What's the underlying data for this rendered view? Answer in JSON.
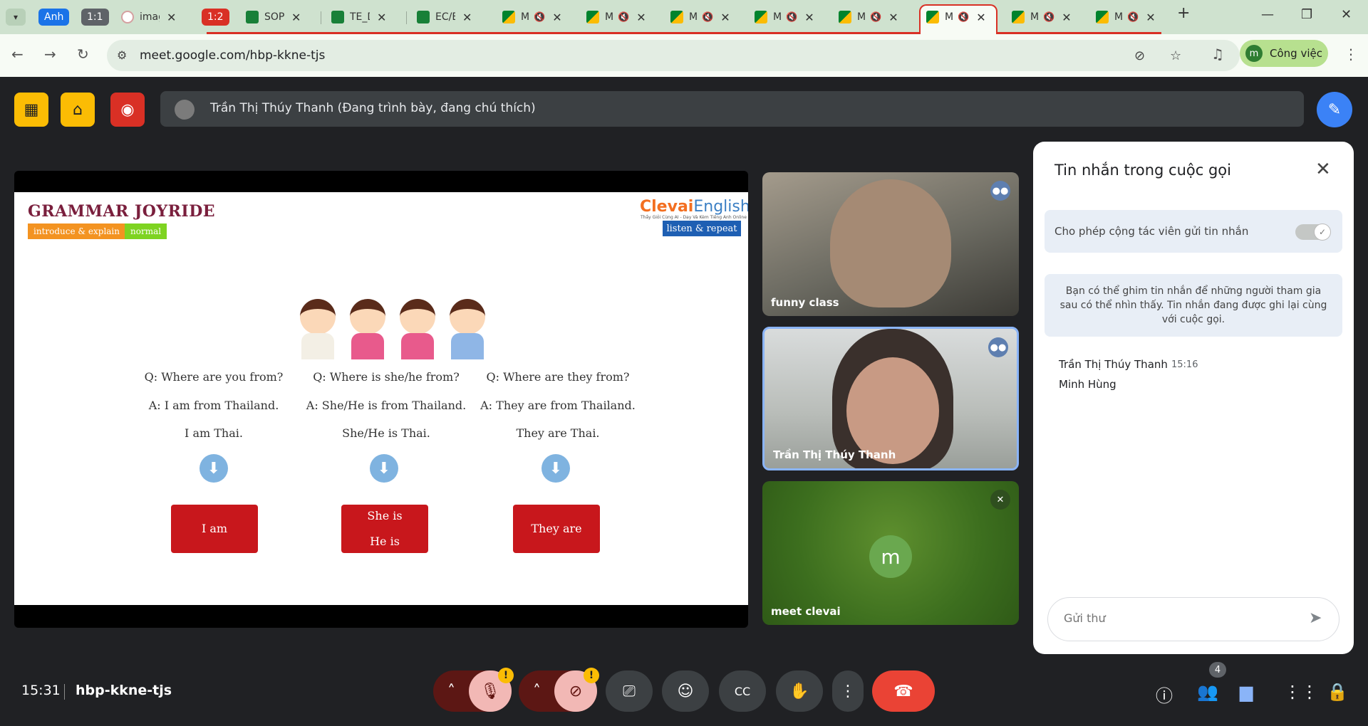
{
  "browser": {
    "tab_groups": [
      {
        "label": "Anh",
        "color": "#1a73e8"
      },
      {
        "label": "1:1",
        "color": "#5f6368"
      },
      {
        "label": "1:2",
        "color": "#d93025"
      }
    ],
    "tabs": [
      {
        "title": "imag"
      },
      {
        "title": "SOP"
      },
      {
        "title": "TE_D"
      },
      {
        "title": "EC/E"
      },
      {
        "title": "M"
      },
      {
        "title": "M"
      },
      {
        "title": "M"
      },
      {
        "title": "M"
      },
      {
        "title": "M"
      },
      {
        "title": "M"
      },
      {
        "title": "M"
      },
      {
        "title": "M"
      }
    ],
    "url": "meet.google.com/hbp-kkne-tjs",
    "profile_initial": "m",
    "profile_name": "Công việc"
  },
  "meet": {
    "presenter_text": "Trần Thị Thúy Thanh (Đang trình bày, đang chú thích)",
    "slide": {
      "title": "GRAMMAR JOYRIDE",
      "tag1": "introduce & explain",
      "tag2": "normal",
      "logo_main": "Clevai",
      "logo_eng": "English",
      "logo_sub": "Thầy Giỏi Cùng AI - Dạy Và Kèm Tiếng Anh Online",
      "listen": "listen & repeat",
      "columns": [
        {
          "q": "Q: Where are you from?",
          "a": "A: I am from Thailand.",
          "b": "I am Thai.",
          "box1": "I am",
          "box2": ""
        },
        {
          "q": "Q: Where is she/he from?",
          "a": "A: She/He is from Thailand.",
          "b": "She/He is Thai.",
          "box1": "She is",
          "box2": "He is"
        },
        {
          "q": "Q: Where are they from?",
          "a": "A: They are from Thailand.",
          "b": "They are Thai.",
          "box1": "They are",
          "box2": ""
        }
      ]
    },
    "participants": [
      {
        "name": "funny class"
      },
      {
        "name": "Trần Thị Thúy Thanh"
      },
      {
        "name": "meet clevai",
        "initial": "m"
      }
    ],
    "chat": {
      "title": "Tin nhắn trong cuộc gọi",
      "toggle_label": "Cho phép cộng tác viên gửi tin nhắn",
      "info": "Bạn có thể ghim tin nhắn để những người tham gia sau có thể nhìn thấy. Tin nhắn đang được ghi lại cùng với cuộc gọi.",
      "messages": [
        {
          "author": "Trần Thị Thúy Thanh",
          "time": "15:16",
          "text": "Minh Hùng"
        }
      ],
      "input_placeholder": "Gửi thư"
    },
    "bottom": {
      "time": "15:31",
      "meeting_code": "hbp-kkne-tjs",
      "participant_count": "4",
      "warn_mark": "!"
    }
  }
}
